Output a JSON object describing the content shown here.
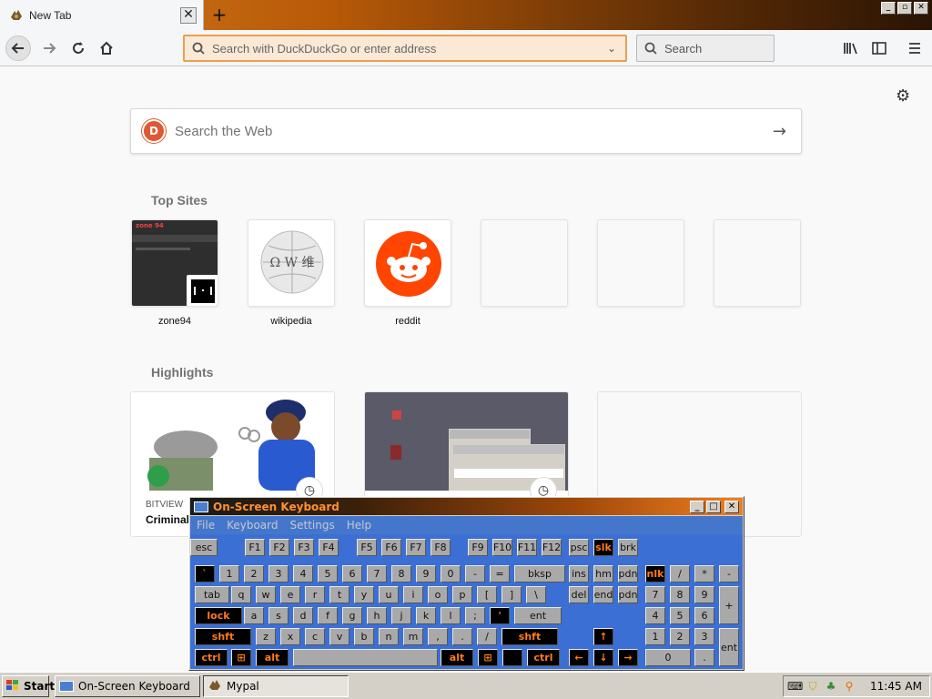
{
  "browser": {
    "tab_title": "New Tab",
    "tab_close": "✕",
    "new_tab": "+",
    "window_controls": [
      "_",
      "▫",
      "✕"
    ],
    "url_placeholder": "Search with DuckDuckGo or enter address",
    "search_placeholder": "Search"
  },
  "newtab": {
    "web_search_placeholder": "Search the Web",
    "top_sites_title": "Top Sites",
    "top_sites": [
      {
        "label": "zone94"
      },
      {
        "label": "wikipedia"
      },
      {
        "label": "reddit"
      },
      {
        "label": ""
      },
      {
        "label": ""
      },
      {
        "label": ""
      }
    ],
    "highlights_title": "Highlights",
    "highlights": [
      {
        "source": "BITVIEW",
        "title": "Criminal"
      },
      {
        "source": "",
        "title": ""
      },
      {
        "source": "",
        "title": ""
      }
    ],
    "zone94_thumb_text": "zone 94",
    "wiki_glyphs": "Ω W 维"
  },
  "osk": {
    "title": "On-Screen Keyboard",
    "menu": [
      "File",
      "Keyboard",
      "Settings",
      "Help"
    ],
    "rows": [
      [
        [
          "esc",
          0,
          0
        ],
        [
          "F1",
          60,
          0
        ],
        [
          "F2",
          87,
          0
        ],
        [
          "F3",
          114,
          0
        ],
        [
          "F4",
          141,
          0
        ],
        [
          "F5",
          183,
          0
        ],
        [
          "F6",
          210,
          0
        ],
        [
          "F7",
          237,
          0
        ],
        [
          "F8",
          264,
          0
        ],
        [
          "F9",
          305,
          0
        ],
        [
          "F10",
          332,
          0
        ],
        [
          "F11",
          359,
          0
        ],
        [
          "F12",
          386,
          0
        ],
        [
          "psc",
          416,
          0
        ],
        [
          "slk",
          443,
          1
        ],
        [
          "brk",
          470,
          0
        ]
      ],
      [
        [
          "`",
          5,
          1
        ],
        [
          "1",
          32,
          0
        ],
        [
          "2",
          59,
          0
        ],
        [
          "3",
          86,
          0
        ],
        [
          "4",
          113,
          0
        ],
        [
          "5",
          140,
          0
        ],
        [
          "6",
          167,
          0
        ],
        [
          "7",
          194,
          0
        ],
        [
          "8",
          221,
          0
        ],
        [
          "9",
          248,
          0
        ],
        [
          "0",
          275,
          0
        ],
        [
          "-",
          302,
          0
        ],
        [
          "=",
          329,
          0
        ],
        [
          "bksp",
          356,
          0
        ],
        [
          "ins",
          416,
          0
        ],
        [
          "hm",
          443,
          0
        ],
        [
          "pdn",
          470,
          0
        ],
        [
          "nlk",
          500,
          1
        ],
        [
          "/",
          527,
          0
        ],
        [
          "*",
          554,
          0
        ],
        [
          "-",
          581,
          0
        ]
      ],
      [
        [
          "tab",
          5,
          0
        ],
        [
          "q",
          45,
          0
        ],
        [
          "w",
          72,
          0
        ],
        [
          "e",
          99,
          0
        ],
        [
          "r",
          126,
          0
        ],
        [
          "t",
          153,
          0
        ],
        [
          "y",
          180,
          0
        ],
        [
          "u",
          207,
          0
        ],
        [
          "i",
          234,
          0
        ],
        [
          "o",
          261,
          0
        ],
        [
          "p",
          288,
          0
        ],
        [
          "[",
          315,
          0
        ],
        [
          "]",
          342,
          0
        ],
        [
          "\\",
          369,
          0
        ],
        [
          "del",
          416,
          0
        ],
        [
          "end",
          443,
          0
        ],
        [
          "pdn",
          470,
          0
        ],
        [
          "7",
          500,
          0
        ],
        [
          "8",
          527,
          0
        ],
        [
          "9",
          554,
          0
        ]
      ],
      [
        [
          "lock",
          5,
          1
        ],
        [
          "a",
          59,
          0
        ],
        [
          "s",
          86,
          0
        ],
        [
          "d",
          113,
          0
        ],
        [
          "f",
          140,
          0
        ],
        [
          "g",
          167,
          0
        ],
        [
          "h",
          194,
          0
        ],
        [
          "j",
          221,
          0
        ],
        [
          "k",
          248,
          0
        ],
        [
          "l",
          275,
          0
        ],
        [
          ";",
          302,
          0
        ],
        [
          "'",
          329,
          1
        ],
        [
          "ent",
          356,
          0
        ],
        [
          "4",
          500,
          0
        ],
        [
          "5",
          527,
          0
        ],
        [
          "6",
          554,
          0
        ]
      ],
      [
        [
          "shft",
          5,
          1
        ],
        [
          "z",
          72,
          0
        ],
        [
          "x",
          99,
          0
        ],
        [
          "c",
          126,
          0
        ],
        [
          "v",
          153,
          0
        ],
        [
          "b",
          180,
          0
        ],
        [
          "n",
          207,
          0
        ],
        [
          "m",
          234,
          0
        ],
        [
          ",",
          261,
          0
        ],
        [
          ".",
          288,
          0
        ],
        [
          "/",
          315,
          0
        ],
        [
          "shft",
          342,
          1
        ],
        [
          "↑",
          443,
          1
        ],
        [
          "1",
          500,
          0
        ],
        [
          "2",
          527,
          0
        ],
        [
          "3",
          554,
          0
        ]
      ],
      [
        [
          "ctrl",
          5,
          1
        ],
        [
          "⊞",
          45,
          1
        ],
        [
          "alt",
          72,
          1
        ],
        [
          "",
          113,
          0
        ],
        [
          "alt",
          275,
          1
        ],
        [
          "⊞",
          316,
          1
        ],
        [
          "",
          343,
          1
        ],
        [
          "ctrl",
          370,
          1
        ],
        [
          "←",
          416,
          1
        ],
        [
          "↓",
          443,
          1
        ],
        [
          "→",
          470,
          1
        ],
        [
          "0",
          500,
          0
        ],
        [
          ".",
          554,
          0
        ]
      ]
    ],
    "tall_keys": [
      [
        "+",
        581
      ],
      [
        "ent",
        581
      ]
    ]
  },
  "taskbar": {
    "start": "Start",
    "tasks": [
      "On-Screen Keyboard",
      "Mypal"
    ],
    "clock": "11:45 AM"
  },
  "colors": {
    "accent_orange": "#e8a14e",
    "osk_blue": "#3b6fd4",
    "reddit": "#ff4500",
    "ddg": "#de5833"
  }
}
